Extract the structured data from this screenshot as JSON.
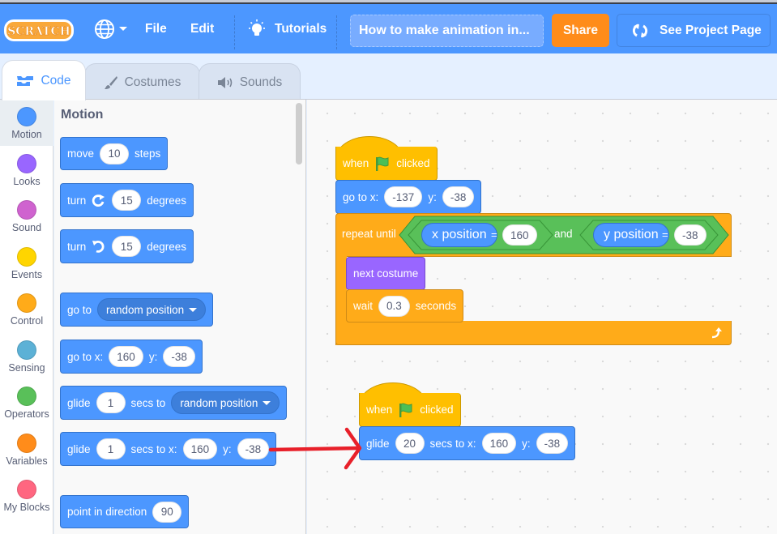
{
  "menubar": {
    "logo_text": "SCRATCH",
    "language_icon": "globe-icon",
    "file_label": "File",
    "edit_label": "Edit",
    "tutorials_label": "Tutorials",
    "project_title": "How to make animation in...",
    "share_label": "Share",
    "see_project_label": "See Project Page"
  },
  "tabs": [
    {
      "label": "Code",
      "icon": "code-blocks-icon",
      "active": true
    },
    {
      "label": "Costumes",
      "icon": "brush-icon",
      "active": false
    },
    {
      "label": "Sounds",
      "icon": "speaker-icon",
      "active": false
    }
  ],
  "categories": [
    {
      "label": "Motion",
      "color": "#4c97ff",
      "selected": true
    },
    {
      "label": "Looks",
      "color": "#9966ff"
    },
    {
      "label": "Sound",
      "color": "#cf63cf"
    },
    {
      "label": "Events",
      "color": "#ffd500"
    },
    {
      "label": "Control",
      "color": "#ffab19"
    },
    {
      "label": "Sensing",
      "color": "#5cb1d6"
    },
    {
      "label": "Operators",
      "color": "#59c059"
    },
    {
      "label": "Variables",
      "color": "#ff8c1a"
    },
    {
      "label": "My Blocks",
      "color": "#ff6680"
    }
  ],
  "flyout": {
    "title": "Motion",
    "blocks": {
      "move": {
        "label": "move",
        "value": "10",
        "suffix": "steps"
      },
      "turn_right": {
        "label": "turn",
        "value": "15",
        "suffix": "degrees"
      },
      "turn_left": {
        "label": "turn",
        "value": "15",
        "suffix": "degrees"
      },
      "goto_menu": {
        "label": "go to",
        "option": "random position"
      },
      "goto_xy": {
        "label": "go to x:",
        "x": "160",
        "ylabel": "y:",
        "y": "-38"
      },
      "glide_menu": {
        "label": "glide",
        "value": "1",
        "mid": "secs to",
        "option": "random position"
      },
      "glide_xy": {
        "label": "glide",
        "value": "1",
        "mid": "secs to x:",
        "x": "160",
        "ylabel": "y:",
        "y": "-38"
      },
      "point_dir": {
        "label": "point in direction",
        "value": "90"
      }
    }
  },
  "script1": {
    "hat": {
      "when": "when",
      "clicked": "clicked"
    },
    "goto": {
      "label": "go to x:",
      "x": "-137",
      "ylabel": "y:",
      "y": "-38"
    },
    "repeat": {
      "label": "repeat until",
      "and": "and",
      "left": {
        "reporter": "x position",
        "op": "=",
        "value": "160"
      },
      "right": {
        "reporter": "y position",
        "op": "=",
        "value": "-38"
      }
    },
    "next_costume": "next costume",
    "wait": {
      "label": "wait",
      "value": "0.3",
      "suffix": "seconds"
    }
  },
  "script2": {
    "hat": {
      "when": "when",
      "clicked": "clicked"
    },
    "glide": {
      "label": "glide",
      "value": "20",
      "mid": "secs to x:",
      "x": "160",
      "ylabel": "y:",
      "y": "-38"
    }
  },
  "annotation": {
    "color": "#e8202a"
  }
}
